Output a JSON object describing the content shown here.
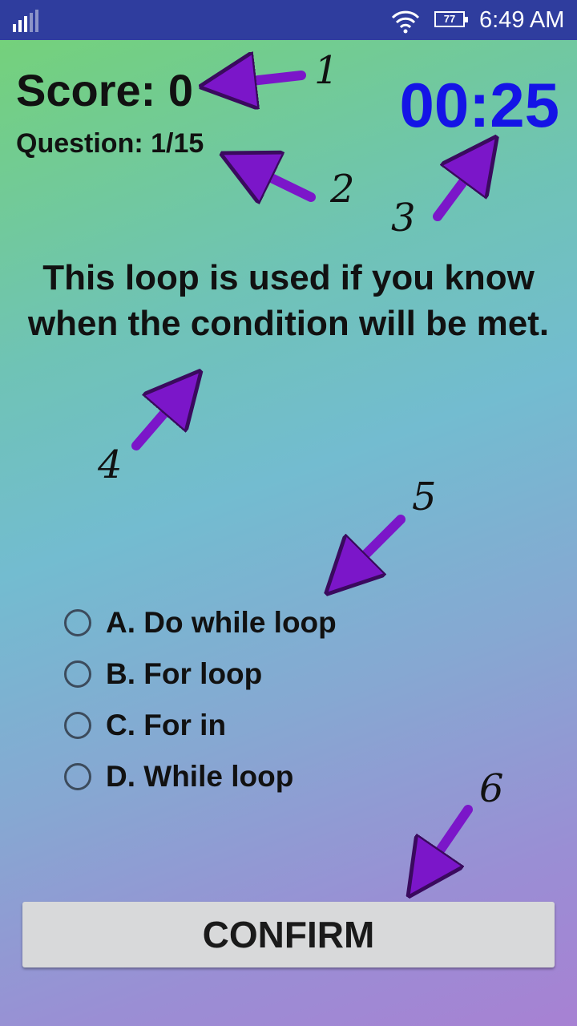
{
  "status_bar": {
    "time": "6:49 AM",
    "battery": "77",
    "icons": [
      "signal-icon",
      "wifi-icon",
      "battery-icon"
    ]
  },
  "quiz": {
    "score": "Score: 0",
    "question_count": "Question: 1/15",
    "timer": "00:25",
    "question": "This loop is used if you know when the condition will be met.",
    "options": [
      {
        "label": "A. Do while loop"
      },
      {
        "label": "B. For loop"
      },
      {
        "label": "C. For in"
      },
      {
        "label": "D. While loop"
      }
    ],
    "confirm_label": "CONFIRM"
  },
  "annotations": {
    "numbers": [
      "1",
      "2",
      "3",
      "4",
      "5",
      "6"
    ],
    "arrow_color": "#7b16c9"
  },
  "colors": {
    "status_bar": "#2f3d9e",
    "timer": "#1414e6",
    "button": "#d8d9da"
  }
}
